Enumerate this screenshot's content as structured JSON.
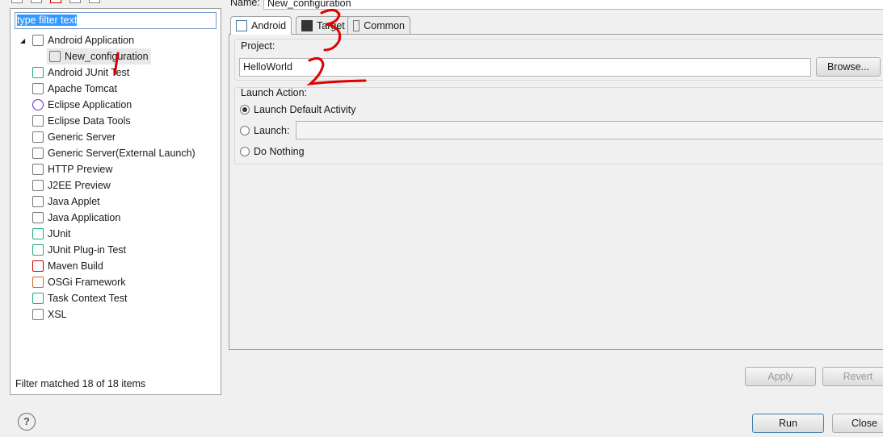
{
  "name_label": "Name:",
  "name_value": "New_configuration",
  "filter": {
    "value": "type filter text"
  },
  "tree": [
    {
      "label": "Android Application",
      "icon": "android-app-icon",
      "expanded": true,
      "level": 0
    },
    {
      "label": "New_configuration",
      "icon": "config-icon",
      "level": 1,
      "selected": true
    },
    {
      "label": "Android JUnit Test",
      "icon": "junit-android-icon",
      "level": 0
    },
    {
      "label": "Apache Tomcat",
      "icon": "server-icon",
      "level": 0
    },
    {
      "label": "Eclipse Application",
      "icon": "eclipse-icon",
      "level": 0
    },
    {
      "label": "Eclipse Data Tools",
      "icon": "database-icon",
      "level": 0
    },
    {
      "label": "Generic Server",
      "icon": "server-icon",
      "level": 0
    },
    {
      "label": "Generic Server(External Launch)",
      "icon": "server-icon",
      "level": 0
    },
    {
      "label": "HTTP Preview",
      "icon": "server-icon",
      "level": 0
    },
    {
      "label": "J2EE Preview",
      "icon": "server-icon",
      "level": 0
    },
    {
      "label": "Java Applet",
      "icon": "applet-icon",
      "level": 0
    },
    {
      "label": "Java Application",
      "icon": "java-app-icon",
      "level": 0
    },
    {
      "label": "JUnit",
      "icon": "junit-icon",
      "level": 0
    },
    {
      "label": "JUnit Plug-in Test",
      "icon": "junit-plugin-icon",
      "level": 0
    },
    {
      "label": "Maven Build",
      "icon": "maven-icon",
      "level": 0
    },
    {
      "label": "OSGi Framework",
      "icon": "osgi-icon",
      "level": 0
    },
    {
      "label": "Task Context Test",
      "icon": "task-junit-icon",
      "level": 0
    },
    {
      "label": "XSL",
      "icon": "xsl-icon",
      "level": 0
    }
  ],
  "status": "Filter matched 18 of 18 items",
  "tabs": [
    {
      "label": "Android",
      "active": true
    },
    {
      "label": "Target"
    },
    {
      "label": "Common"
    }
  ],
  "project_label": "Project:",
  "project_value": "HelloWorld",
  "browse": "Browse...",
  "launch_action_label": "Launch Action:",
  "options": [
    {
      "label": "Launch Default Activity",
      "selected": true
    },
    {
      "label": "Launch:"
    },
    {
      "label": "Do Nothing"
    }
  ],
  "buttons": {
    "apply": "Apply",
    "revert": "Revert",
    "run": "Run",
    "close": "Close"
  },
  "annotation_color": "#e00000"
}
